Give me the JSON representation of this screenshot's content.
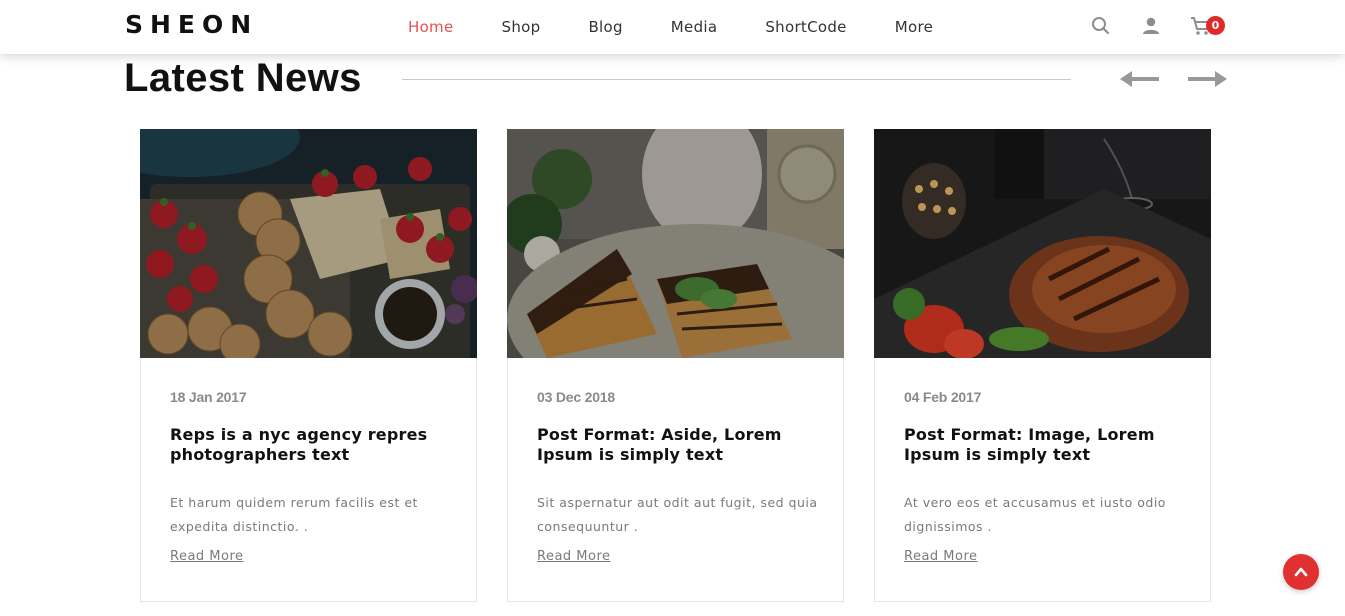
{
  "header": {
    "logo": "SHEON",
    "nav": [
      {
        "label": "Home",
        "active": true
      },
      {
        "label": "Shop",
        "active": false
      },
      {
        "label": "Blog",
        "active": false
      },
      {
        "label": "Media",
        "active": false
      },
      {
        "label": "ShortCode",
        "active": false
      },
      {
        "label": "More",
        "active": false
      }
    ],
    "icons": [
      "search-icon",
      "user-icon",
      "cart-icon"
    ],
    "cart_count": "0"
  },
  "section": {
    "title": "Latest News",
    "prev_icon": "arrow-left-icon",
    "next_icon": "arrow-right-icon"
  },
  "posts": [
    {
      "date": "18 Jan 2017",
      "title": "Reps is a nyc agency repres photographers text",
      "excerpt": "Et harum quidem rerum facilis est et expedita distinctio. .",
      "link": "Read More"
    },
    {
      "date": "03 Dec 2018",
      "title": "Post Format: Aside, Lorem Ipsum is simply text",
      "excerpt": "Sit aspernatur aut odit aut fugit, sed quia consequuntur .",
      "link": "Read More"
    },
    {
      "date": "04 Feb 2017",
      "title": "Post Format: Image, Lorem Ipsum is simply text",
      "excerpt": "At vero eos et accusamus et iusto odio dignissimos .",
      "link": "Read More"
    }
  ],
  "colors": {
    "accent": "#e84f4f",
    "badge": "#e02929",
    "to_top": "#e03030"
  },
  "to_top_icon": "chevron-up-icon"
}
